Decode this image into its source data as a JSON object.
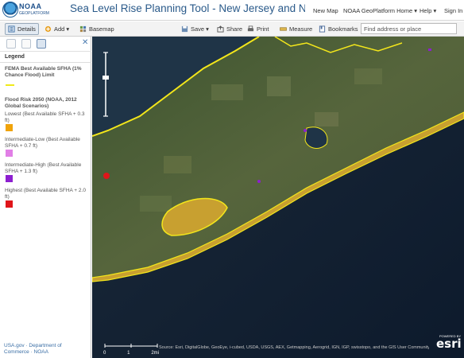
{
  "header": {
    "logo_name": "NOAA",
    "logo_sub": "GEOPLATFORM",
    "title": "Sea Level Rise Planning Tool - New Jersey and New Yor…",
    "links": [
      "New Map",
      "NOAA GeoPlatform Home ▾",
      "Help ▾",
      "Sign In"
    ]
  },
  "toolbar": {
    "details": "Details",
    "add": "Add ▾",
    "basemap": "Basemap",
    "save": "Save ▾",
    "share": "Share",
    "print": "Print",
    "measure": "Measure",
    "bookmarks": "Bookmarks",
    "search_placeholder": "Find address or place"
  },
  "sidebar": {
    "legend_heading": "Legend",
    "fema_title": "FEMA Best Available SFHA (1% Chance Flood) Limit",
    "flood_title": "Flood Risk 2050 (NOAA, 2012 Global Scenarios)",
    "items": [
      {
        "label": "Lowest (Best Available SFHA + 0.3 ft)",
        "color": "#f0a30a"
      },
      {
        "label": "Intermediate-Low (Best Available SFHA + 0.7 ft)",
        "color": "#e17fe6"
      },
      {
        "label": "Intermediate-High (Best Available SFHA + 1.3 ft)",
        "color": "#8d1fd0"
      },
      {
        "label": "Highest (Best Available SFHA + 2.0 ft)",
        "color": "#e0151a"
      }
    ],
    "footer": "USA.gov  ·  Department of Commerce  ·  NOAA"
  },
  "map": {
    "scale_labels": [
      "0",
      "1",
      "2mi"
    ],
    "attribution": "Source: Esri, DigitalGlobe, GeoEye, i-cubed, USDA, USGS, AEX, Getmapping, Aerogrid, IGN, IGP, swisstopo, and the GIS User Community | FEMA",
    "powered_by": "POWERED BY",
    "esri": "esri"
  }
}
